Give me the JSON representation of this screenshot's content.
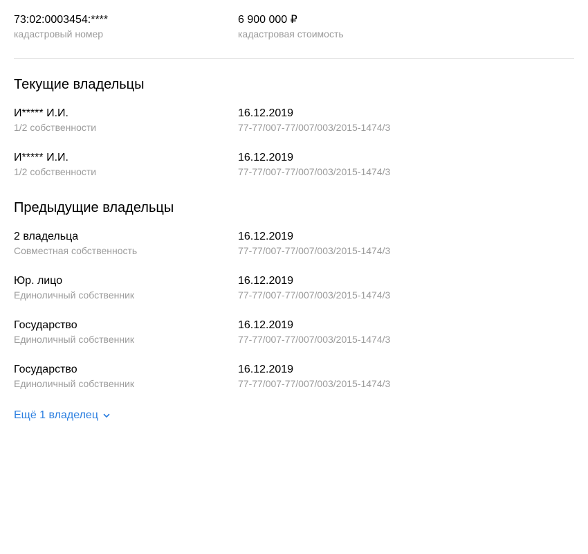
{
  "summary": {
    "cadastral_number": "73:02:0003454:****",
    "cadastral_number_label": "кадастровый номер",
    "cadastral_value": "6 900 000 ₽",
    "cadastral_value_label": "кадастровая стоимость"
  },
  "current_owners": {
    "title": "Текущие владельцы",
    "items": [
      {
        "name": "И***** И.И.",
        "share": "1/2 собственности",
        "date": "16.12.2019",
        "record": "77-77/007-77/007/003/2015-1474/3"
      },
      {
        "name": "И***** И.И.",
        "share": "1/2 собственности",
        "date": "16.12.2019",
        "record": "77-77/007-77/007/003/2015-1474/3"
      }
    ]
  },
  "previous_owners": {
    "title": "Предыдущие владельцы",
    "items": [
      {
        "name": "2 владельца",
        "share": "Совместная собственность",
        "date": "16.12.2019",
        "record": "77-77/007-77/007/003/2015-1474/3"
      },
      {
        "name": "Юр. лицо",
        "share": "Единоличный собственник",
        "date": "16.12.2019",
        "record": "77-77/007-77/007/003/2015-1474/3"
      },
      {
        "name": "Государство",
        "share": "Единоличный собственник",
        "date": "16.12.2019",
        "record": "77-77/007-77/007/003/2015-1474/3"
      },
      {
        "name": "Государство",
        "share": "Единоличный собственник",
        "date": "16.12.2019",
        "record": "77-77/007-77/007/003/2015-1474/3"
      }
    ],
    "more_label": "Ещё 1 владелец",
    "more_icon": "chevron-down-icon"
  },
  "colors": {
    "text": "#000000",
    "muted": "#9b9b9b",
    "link": "#2a7ee0",
    "divider": "#e6e6e6"
  }
}
